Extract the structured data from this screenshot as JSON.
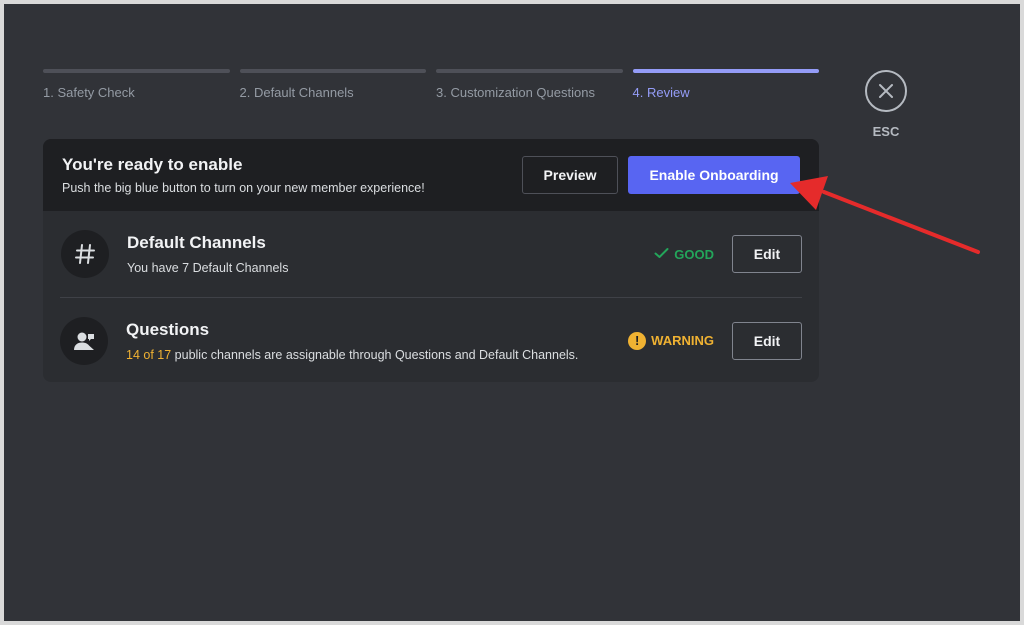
{
  "stepper": {
    "steps": [
      {
        "label": "1. Safety Check"
      },
      {
        "label": "2. Default Channels"
      },
      {
        "label": "3. Customization Questions"
      },
      {
        "label": "4. Review"
      }
    ]
  },
  "esc": {
    "label": "ESC",
    "icon": "close-icon"
  },
  "header": {
    "title": "You're ready to enable",
    "subtitle": "Push the big blue button to turn on your new member experience!",
    "preview_label": "Preview",
    "enable_label": "Enable Onboarding"
  },
  "rows": [
    {
      "icon": "hash-icon",
      "title": "Default Channels",
      "subtitle": "You have 7 Default Channels",
      "status": "GOOD",
      "edit_label": "Edit"
    },
    {
      "icon": "user-chat-icon",
      "title": "Questions",
      "subtitle_highlight": "14 of 17",
      "subtitle_rest": " public channels are assignable through Questions and Default Channels.",
      "status": "WARNING",
      "edit_label": "Edit"
    }
  ],
  "colors": {
    "background": "#313338",
    "card": "#2b2d31",
    "header": "#1e1f22",
    "accent": "#5865f2",
    "active_step": "#949cf7",
    "good": "#23a55a",
    "warning": "#f0b232",
    "annotation_arrow": "#e52b2b"
  }
}
